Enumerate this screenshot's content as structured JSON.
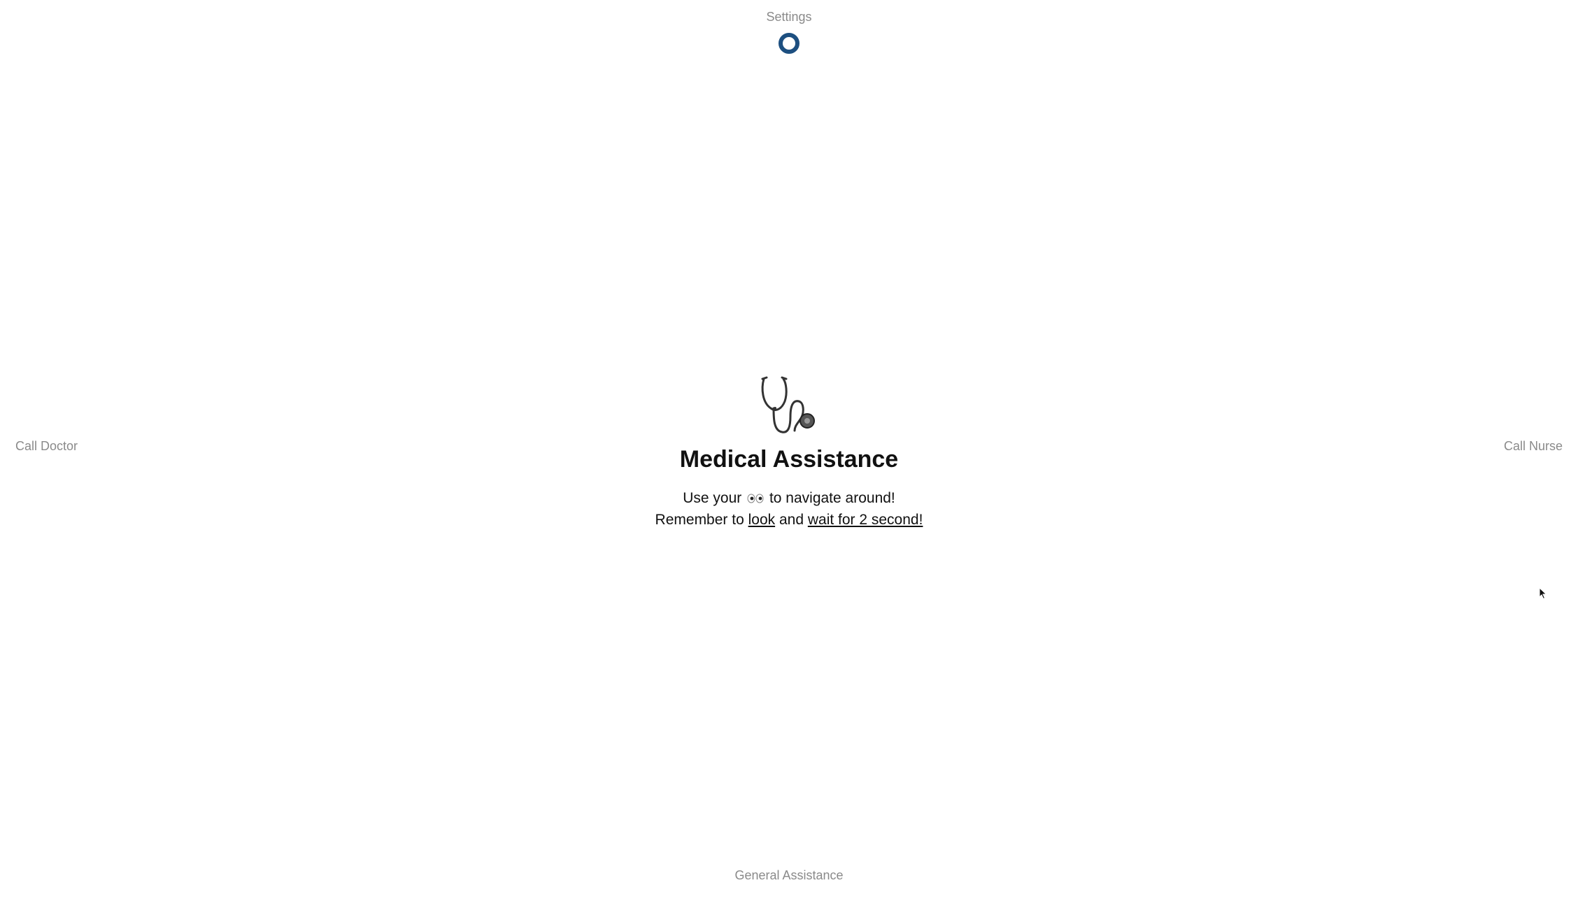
{
  "nav": {
    "top_label": "Settings",
    "left_label": "Call Doctor",
    "right_label": "Call Nurse",
    "bottom_label": "General Assistance"
  },
  "main": {
    "icon": "stethoscope-icon",
    "title": "Medical Assistance",
    "line1_before": "Use your",
    "line1_icon": "eyes-icon",
    "line1_after": "to navigate around!",
    "line2_before": "Remember to ",
    "line2_link1": "look",
    "line2_middle": " and ",
    "line2_link2": "wait for 2 second!"
  },
  "colors": {
    "accent": "#1d4f80",
    "nav_text": "#8a8a8a",
    "text": "#111111"
  }
}
